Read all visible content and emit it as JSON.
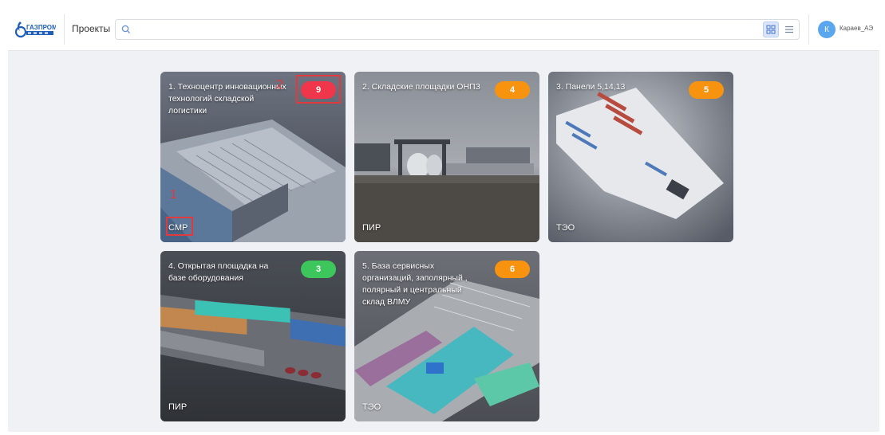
{
  "header": {
    "logo_text": "ГАЗПРОМ",
    "title": "Проекты",
    "search_placeholder": "",
    "user_initial": "К",
    "user_name": "Караев_АЭ"
  },
  "projects": [
    {
      "title": "1. Техноцентр инновационных технологий складской логистики",
      "count": "9",
      "badge_color": "#f0364a",
      "stage": "СМР"
    },
    {
      "title": "2. Складские площадки ОНПЗ",
      "count": "4",
      "badge_color": "#f7930f",
      "stage": "ПИР"
    },
    {
      "title": "3. Панели 5,14,13",
      "count": "5",
      "badge_color": "#f7930f",
      "stage": "ТЭО"
    },
    {
      "title": "4. Открытая площадка на базе оборудования",
      "count": "3",
      "badge_color": "#3cc65c",
      "stage": "ПИР"
    },
    {
      "title": "5. База сервисных организаций, заполярный , полярный и центральный склад ВЛМУ",
      "count": "6",
      "badge_color": "#f7930f",
      "stage": "ТЭО"
    }
  ],
  "annotations": {
    "first": "1",
    "second": "2"
  },
  "colors": {
    "accent": "#5aa7ef",
    "annotation": "#e0393e"
  }
}
